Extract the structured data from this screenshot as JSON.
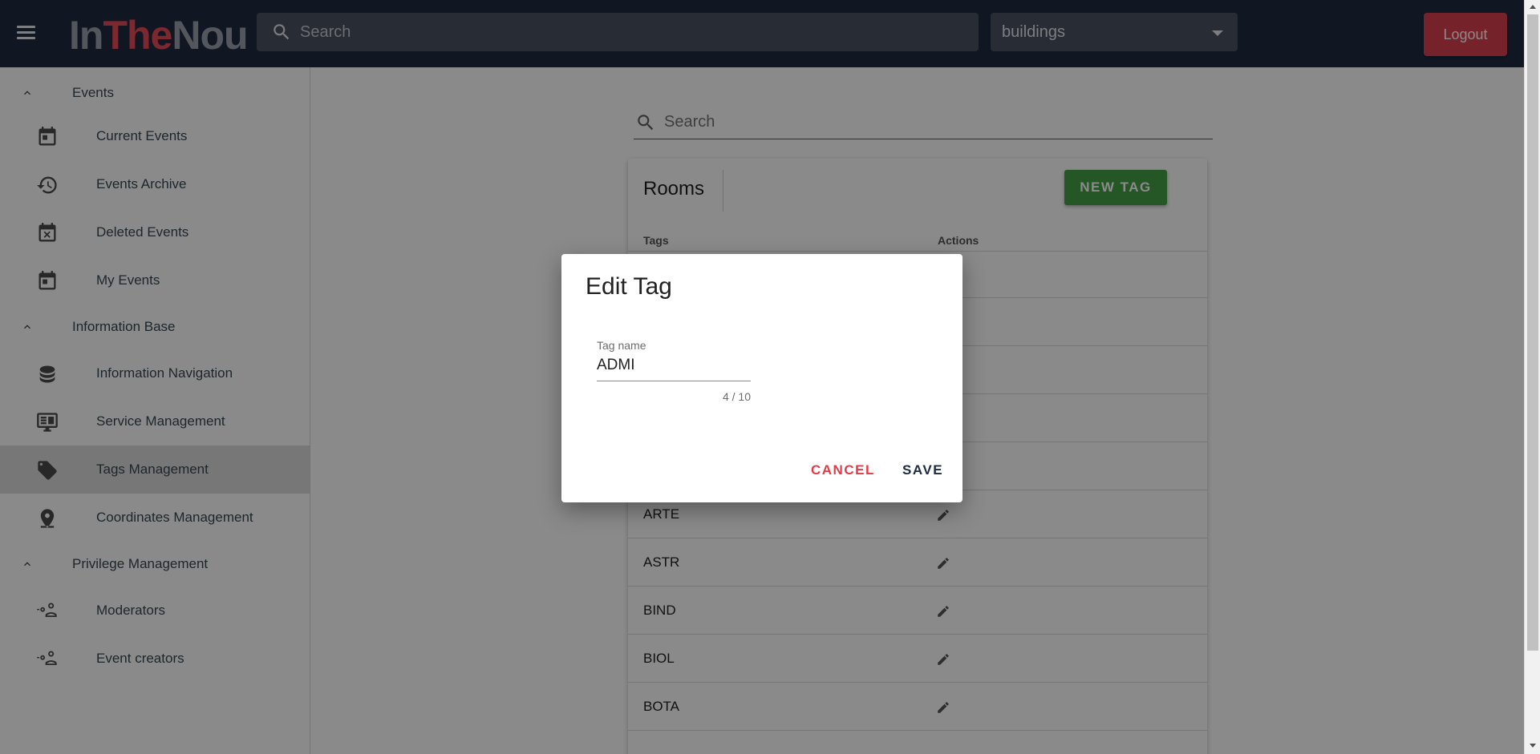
{
  "header": {
    "logo_part1": "In",
    "logo_part2": "The",
    "logo_part3": "Nou",
    "search_placeholder": "Search",
    "select_value": "buildings",
    "logout_label": "Logout"
  },
  "sidebar": {
    "groups": [
      {
        "label": "Events",
        "items": [
          {
            "label": "Current Events",
            "icon": "calendar-icon"
          },
          {
            "label": "Events Archive",
            "icon": "history-icon"
          },
          {
            "label": "Deleted Events",
            "icon": "calendar-remove-icon"
          },
          {
            "label": "My Events",
            "icon": "calendar-icon"
          }
        ]
      },
      {
        "label": "Information Base",
        "items": [
          {
            "label": "Information Navigation",
            "icon": "database-icon"
          },
          {
            "label": "Service Management",
            "icon": "monitor-icon"
          },
          {
            "label": "Tags Management",
            "icon": "tags-icon",
            "active": true
          },
          {
            "label": "Coordinates Management",
            "icon": "map-marker-icon"
          }
        ]
      },
      {
        "label": "Privilege Management",
        "items": [
          {
            "label": "Moderators",
            "icon": "account-key-icon"
          },
          {
            "label": "Event creators",
            "icon": "account-key-icon"
          }
        ]
      }
    ]
  },
  "main": {
    "search_placeholder": "Search",
    "card_title": "Rooms",
    "new_tag_label": "NEW TAG",
    "col_tags": "Tags",
    "col_actions": "Actions",
    "rows": [
      {
        "tag": ""
      },
      {
        "tag": ""
      },
      {
        "tag": ""
      },
      {
        "tag": ""
      },
      {
        "tag": ""
      },
      {
        "tag": "ARTE"
      },
      {
        "tag": "ASTR"
      },
      {
        "tag": "BIND"
      },
      {
        "tag": "BIOL"
      },
      {
        "tag": "BOTA"
      }
    ]
  },
  "dialog": {
    "title": "Edit Tag",
    "field_label": "Tag name",
    "field_value": "ADMI",
    "counter": "4 / 10",
    "cancel_label": "CANCEL",
    "save_label": "SAVE"
  },
  "colors": {
    "topbar": "#1f2a40",
    "logo_accent": "#e34b56",
    "logout": "#d9404e",
    "new_tag": "#43a047",
    "cancel": "#e53945"
  }
}
